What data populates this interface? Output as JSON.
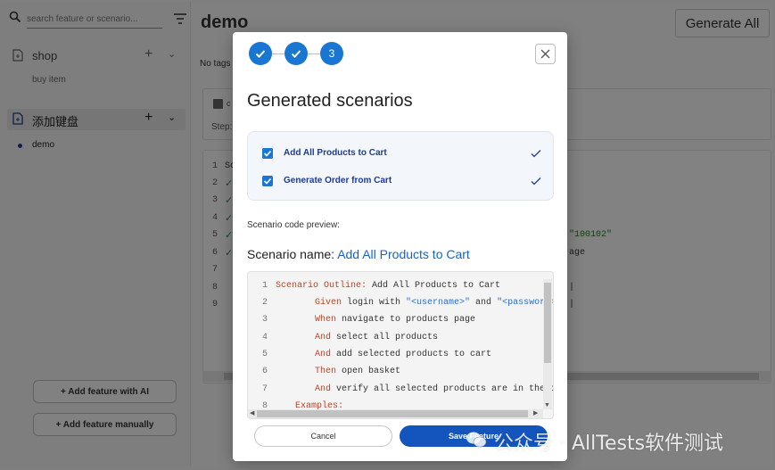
{
  "sidebar": {
    "search_placeholder": "search feature or scenario...",
    "features": [
      {
        "label": "shop",
        "scenarios": [
          "buy item"
        ]
      },
      {
        "label": "添加键盘",
        "scenarios": [
          "demo"
        ]
      }
    ],
    "add_with_ai_label": "+ Add feature with AI",
    "add_manually_label": "+ Add feature manually"
  },
  "main": {
    "title": "demo",
    "generate_all_label": "Generate All",
    "no_tags_label": "No tags",
    "step_label": "Step:",
    "panel_label": "c",
    "line_numbers": [
      "1",
      "2",
      "3",
      "4",
      "5",
      "6",
      "7",
      "8",
      "9"
    ],
    "visible_code_fragments": [
      "Sc",
      "\"100102\"",
      "age",
      "|",
      "|"
    ]
  },
  "modal": {
    "stepper": {
      "steps": [
        "",
        "",
        "3"
      ],
      "current_step": 3
    },
    "title": "Generated scenarios",
    "scenarios": [
      {
        "label": "Add All Products to Cart",
        "checked": true
      },
      {
        "label": "Generate Order from Cart",
        "checked": true
      }
    ],
    "preview_label": "Scenario code preview:",
    "scenario_name_label": "Scenario name:",
    "scenario_name_value": "Add All Products to Cart",
    "code_lines": [
      {
        "num": "1",
        "kw": "Scenario Outline:",
        "rest": " Add All Products to Cart",
        "indent": ""
      },
      {
        "num": "2",
        "kw": "Given",
        "rest": " login with ",
        "s1": "\"<username>\"",
        "mid": " and ",
        "s2": "\"<password>\"",
        "indent": "      "
      },
      {
        "num": "3",
        "kw": "When",
        "rest": " navigate to products page",
        "indent": "      "
      },
      {
        "num": "4",
        "kw": "And",
        "rest": " select all products",
        "indent": "      "
      },
      {
        "num": "5",
        "kw": "And",
        "rest": " add selected products to cart",
        "indent": "      "
      },
      {
        "num": "6",
        "kw": "Then",
        "rest": " open basket",
        "indent": "      "
      },
      {
        "num": "7",
        "kw": "And",
        "rest": " verify all selected products are in the ca",
        "indent": "      "
      },
      {
        "num": "8",
        "kw": "Examples:",
        "rest": "",
        "indent": "   "
      }
    ],
    "cancel_label": "Cancel",
    "save_label": "Save Feature"
  },
  "watermark": {
    "text": "公众号 · AllTests软件测试"
  },
  "colors": {
    "accent": "#1976d2",
    "save_button": "#1454bd",
    "scenario_text": "#1f3c8f",
    "keyword": "#b5452a",
    "string": "#2a6fcf"
  }
}
